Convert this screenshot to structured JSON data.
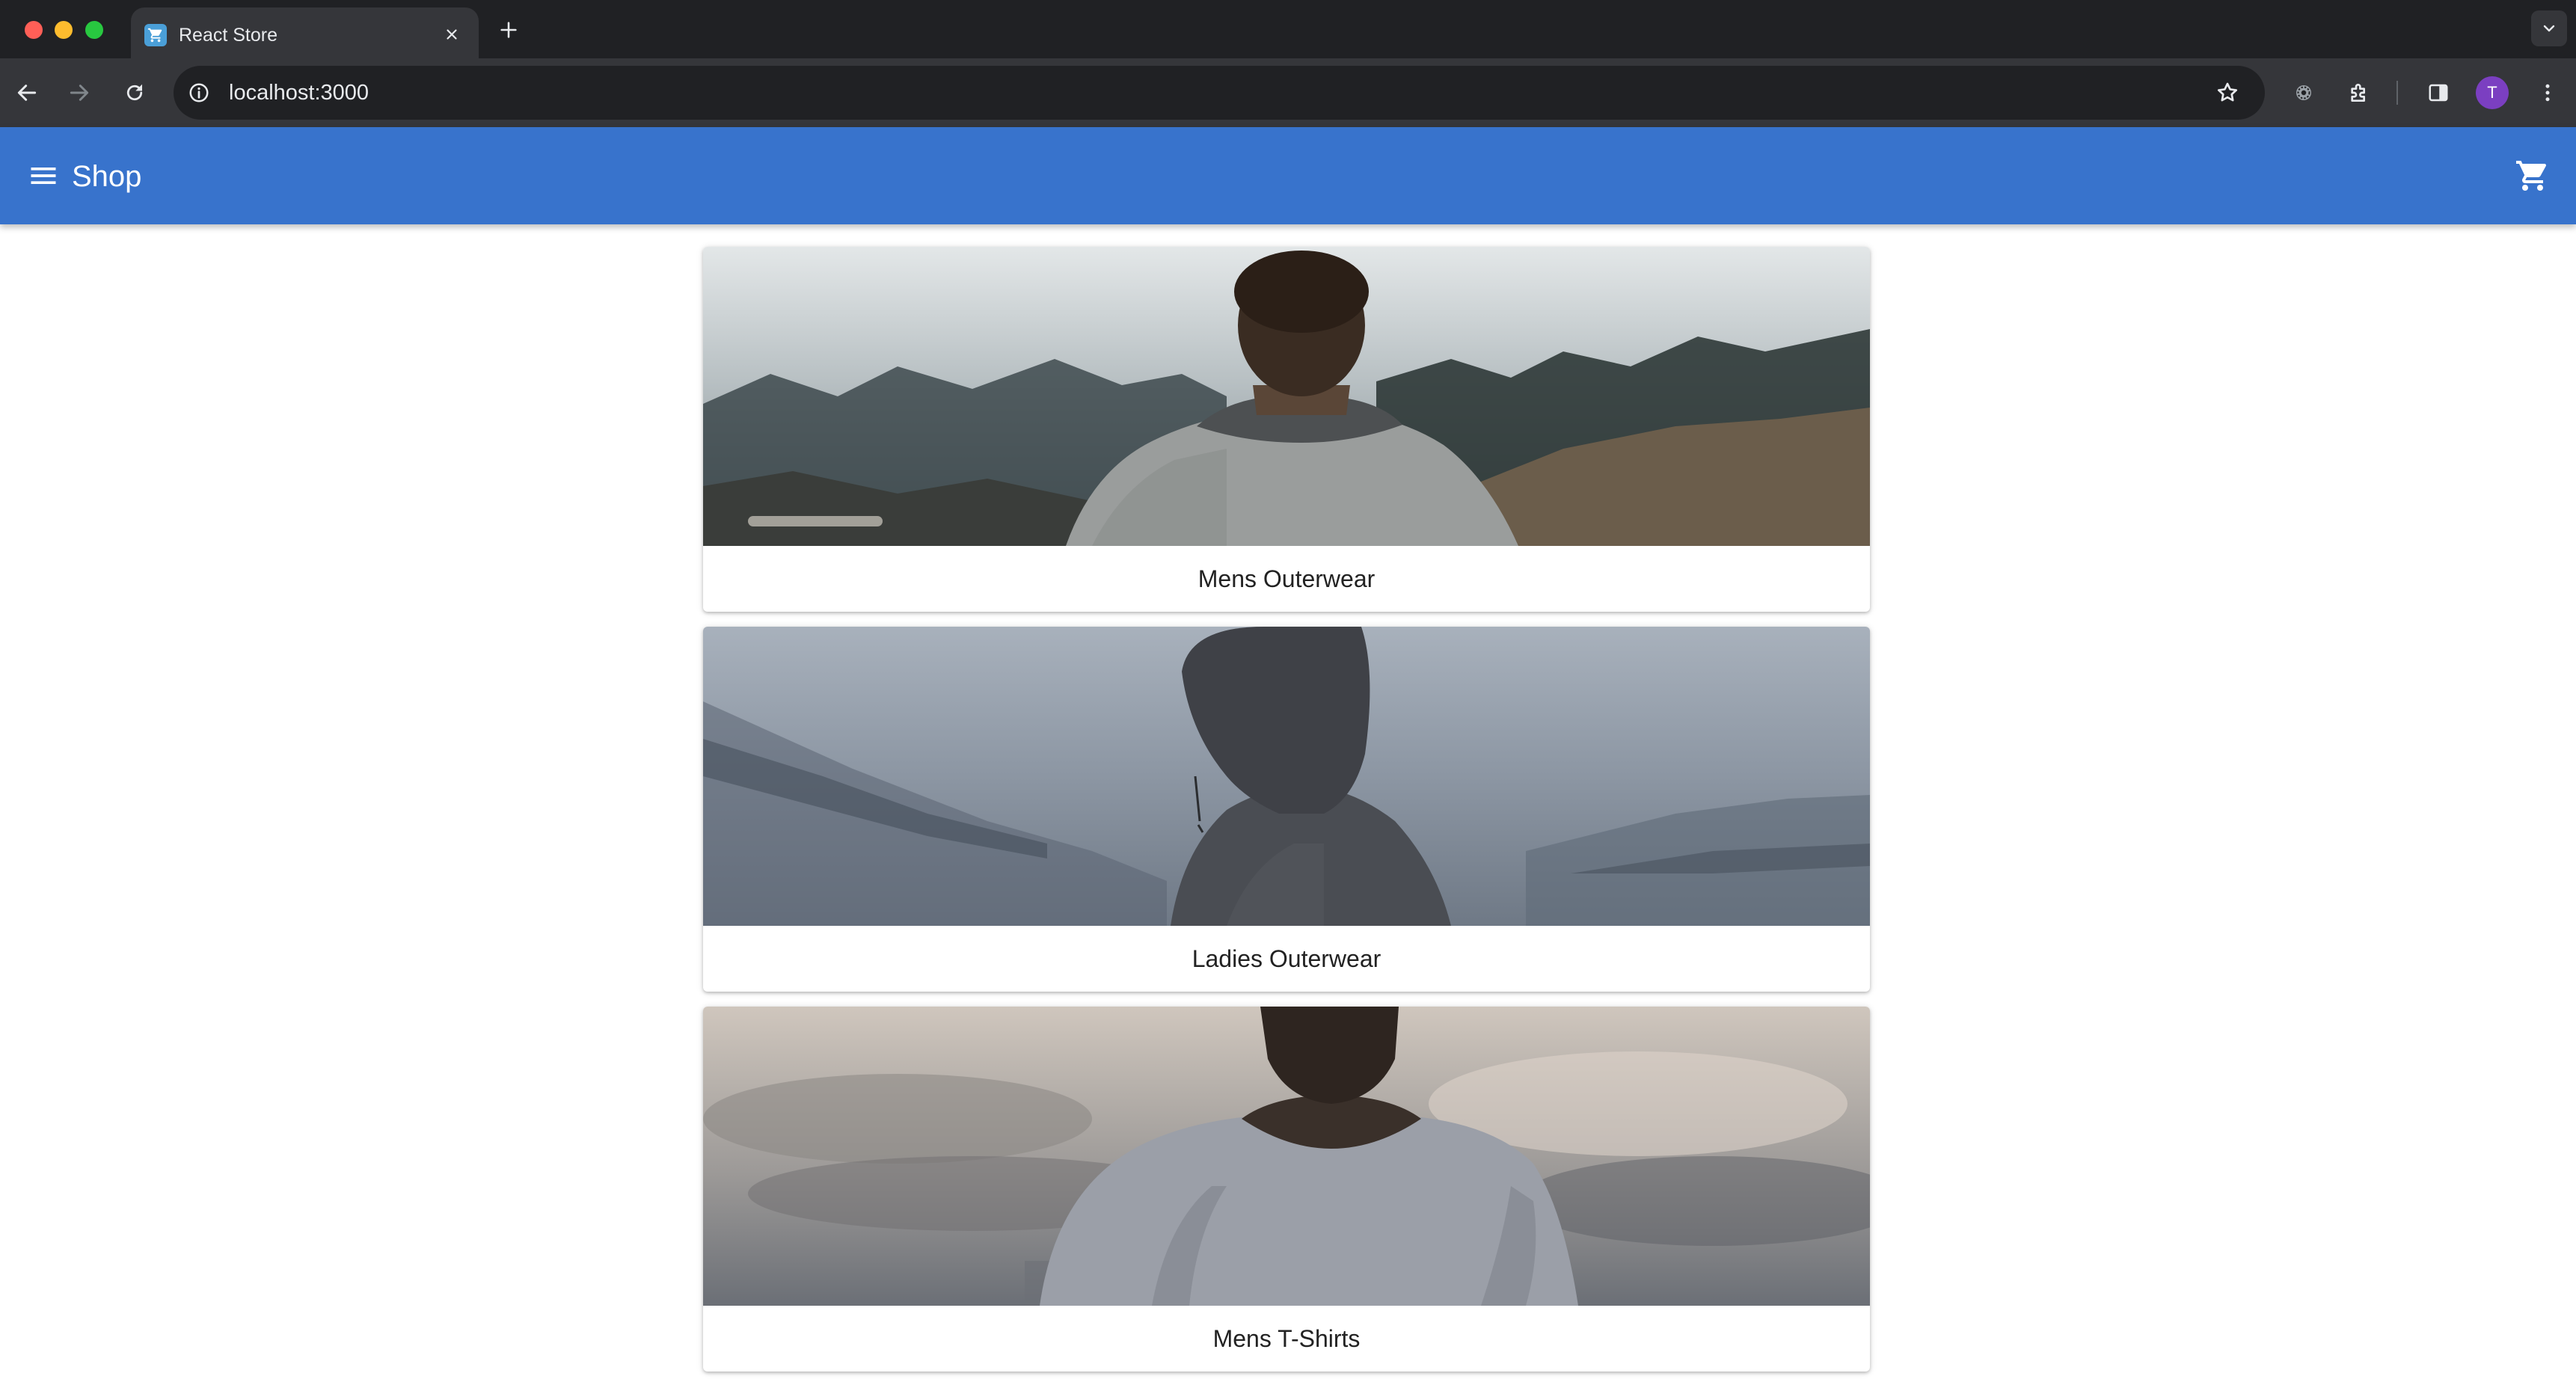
{
  "browser": {
    "tab_title": "React Store",
    "url": "localhost:3000",
    "profile_initial": "T"
  },
  "app": {
    "title": "Shop",
    "icons": {
      "menu": "menu-icon",
      "cart": "shopping-cart-icon"
    },
    "colors": {
      "appbar": "#3873cc"
    }
  },
  "categories": [
    {
      "label": "Mens Outerwear",
      "image": "man-in-grey-sweater-facing-foggy-hills"
    },
    {
      "label": "Ladies Outerwear",
      "image": "person-in-knit-hood-facing-misty-sea"
    },
    {
      "label": "Mens T-Shirts",
      "image": "man-in-t-shirt-facing-cloudy-sky"
    }
  ]
}
